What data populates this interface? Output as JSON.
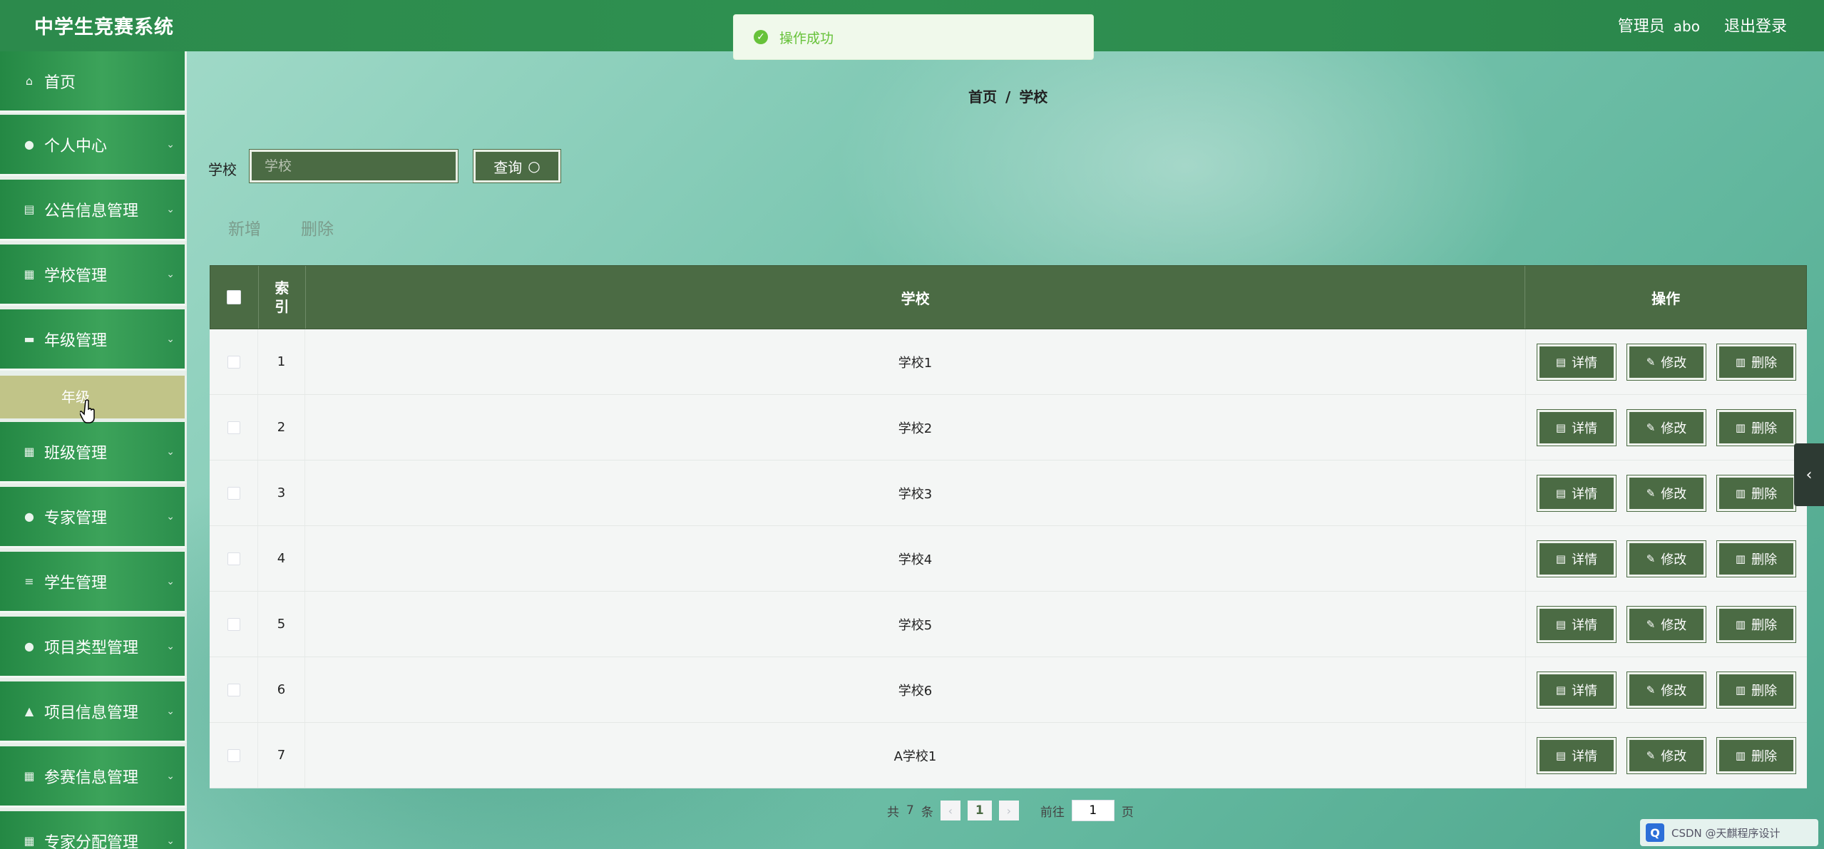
{
  "app": {
    "title": "中学生竞赛系统"
  },
  "header": {
    "role": "管理员",
    "username": "abo",
    "logout": "退出登录"
  },
  "toast": {
    "message": "操作成功"
  },
  "sidebar": {
    "items": [
      {
        "label": "首页",
        "icon": "home-icon"
      },
      {
        "label": "个人中心",
        "icon": "user-icon"
      },
      {
        "label": "公告信息管理",
        "icon": "clipboard-icon"
      },
      {
        "label": "学校管理",
        "icon": "grid-icon"
      },
      {
        "label": "年级管理",
        "icon": "chat-icon"
      },
      {
        "label": "班级管理",
        "icon": "apps-icon"
      },
      {
        "label": "专家管理",
        "icon": "person-icon"
      },
      {
        "label": "学生管理",
        "icon": "list-icon"
      },
      {
        "label": "项目类型管理",
        "icon": "person-icon"
      },
      {
        "label": "项目信息管理",
        "icon": "thumb-icon"
      },
      {
        "label": "参赛信息管理",
        "icon": "grid-icon"
      },
      {
        "label": "专家分配管理",
        "icon": "grid-icon"
      }
    ],
    "submenu": {
      "label": "年级"
    }
  },
  "breadcrumb": {
    "home": "首页",
    "separator": "/",
    "current": "学校"
  },
  "search": {
    "label": "学校",
    "placeholder": "学校",
    "button": "查询"
  },
  "actions": {
    "add": "新增",
    "delete": "删除"
  },
  "table": {
    "headers": {
      "index": "索\n引",
      "name": "学校",
      "ops": "操作"
    },
    "op_labels": {
      "detail": "详情",
      "edit": "修改",
      "delete": "删除"
    },
    "rows": [
      {
        "index": "1",
        "name": "学校1"
      },
      {
        "index": "2",
        "name": "学校2"
      },
      {
        "index": "3",
        "name": "学校3"
      },
      {
        "index": "4",
        "name": "学校4"
      },
      {
        "index": "5",
        "name": "学校5"
      },
      {
        "index": "6",
        "name": "学校6"
      },
      {
        "index": "7",
        "name": "A学校1"
      }
    ]
  },
  "pagination": {
    "total_prefix": "共",
    "total": "7",
    "total_suffix": "条",
    "current_page": "1",
    "goto_label": "前往",
    "goto_value": "1",
    "page_suffix": "页"
  },
  "watermark": {
    "text": "CSDN @天麒程序设计"
  },
  "colors": {
    "header": "#2f9151",
    "sidebar_item": "#3ca35a",
    "submenu_active": "#c1c488",
    "table_head": "#4b6b44",
    "toast": "#67c23a"
  }
}
